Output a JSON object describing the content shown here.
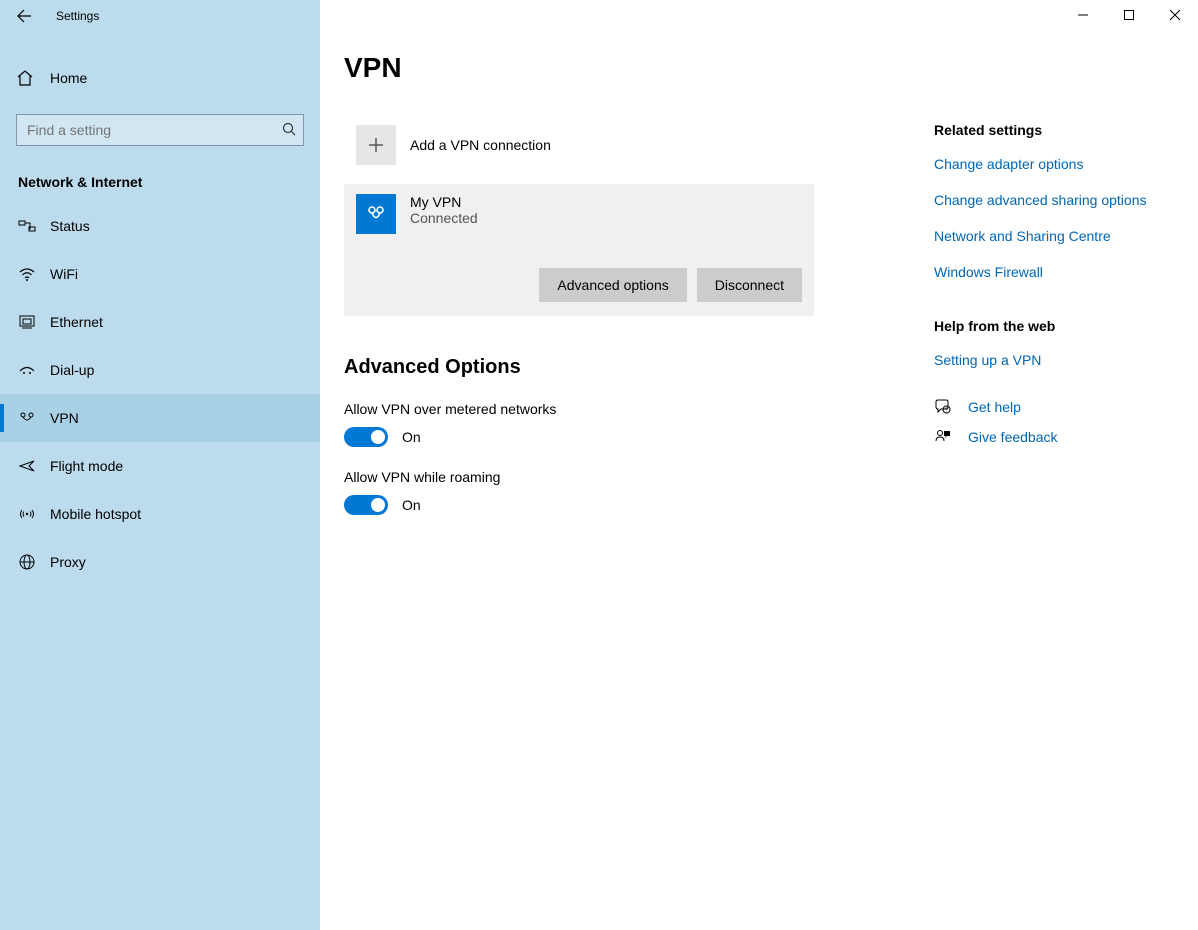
{
  "window": {
    "title": "Settings"
  },
  "sidebar": {
    "home": "Home",
    "search_placeholder": "Find a setting",
    "section": "Network & Internet",
    "items": [
      {
        "label": "Status",
        "icon": "status-icon"
      },
      {
        "label": "WiFi",
        "icon": "wifi-icon"
      },
      {
        "label": "Ethernet",
        "icon": "ethernet-icon"
      },
      {
        "label": "Dial-up",
        "icon": "dialup-icon"
      },
      {
        "label": "VPN",
        "icon": "vpn-icon",
        "active": true
      },
      {
        "label": "Flight mode",
        "icon": "flight-mode-icon"
      },
      {
        "label": "Mobile hotspot",
        "icon": "hotspot-icon"
      },
      {
        "label": "Proxy",
        "icon": "proxy-icon"
      }
    ]
  },
  "page": {
    "title": "VPN",
    "add_vpn_label": "Add a VPN connection",
    "connection": {
      "name": "My VPN",
      "status": "Connected",
      "advanced_button": "Advanced options",
      "disconnect_button": "Disconnect"
    },
    "advanced_heading": "Advanced Options",
    "toggles": [
      {
        "label": "Allow VPN over metered networks",
        "on": true,
        "state_text": "On"
      },
      {
        "label": "Allow VPN while roaming",
        "on": true,
        "state_text": "On"
      }
    ]
  },
  "related": {
    "heading": "Related settings",
    "links": [
      "Change adapter options",
      "Change advanced sharing options",
      "Network and Sharing Centre",
      "Windows Firewall"
    ],
    "help_heading": "Help from the web",
    "help_links": [
      "Setting up a VPN"
    ],
    "get_help": "Get help",
    "feedback": "Give feedback"
  }
}
